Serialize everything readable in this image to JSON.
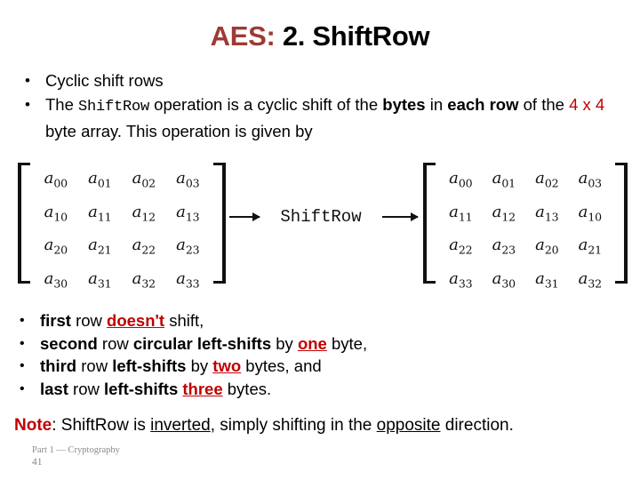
{
  "slide": {
    "title_accent": "AES:",
    "title_main": " 2. ShiftRow",
    "accent_color": "#9e3a35",
    "emphasis_color": "#c00000"
  },
  "intro_bullets": [
    {
      "bullet": "•",
      "parts": [
        {
          "text": "Cyclic shift rows",
          "style": "plain"
        }
      ]
    },
    {
      "bullet": "•",
      "parts": [
        {
          "text": "The ",
          "style": "plain"
        },
        {
          "text": "ShiftRow",
          "style": "mono"
        },
        {
          "text": " operation is a cyclic shift of the ",
          "style": "plain"
        },
        {
          "text": "bytes",
          "style": "bold"
        },
        {
          "text": " in ",
          "style": "plain"
        },
        {
          "text": "each row",
          "style": "bold"
        },
        {
          "text": " of the ",
          "style": "plain"
        },
        {
          "text": "4 x 4",
          "style": "red"
        },
        {
          "text": " byte array. This operation is given by",
          "style": "plain"
        }
      ]
    }
  ],
  "diagram": {
    "input_matrix": {
      "rows": [
        [
          "a00",
          "a01",
          "a02",
          "a03"
        ],
        [
          "a10",
          "a11",
          "a12",
          "a13"
        ],
        [
          "a20",
          "a21",
          "a22",
          "a23"
        ],
        [
          "a30",
          "a31",
          "a32",
          "a33"
        ]
      ]
    },
    "operation_label": "ShiftRow",
    "arrow_left": "⟶",
    "arrow_right": "⟶",
    "output_matrix": {
      "rows": [
        [
          "a00",
          "a01",
          "a02",
          "a03"
        ],
        [
          "a11",
          "a12",
          "a13",
          "a10"
        ],
        [
          "a22",
          "a23",
          "a20",
          "a21"
        ],
        [
          "a33",
          "a30",
          "a31",
          "a32"
        ]
      ]
    }
  },
  "rule_bullets": [
    {
      "bullet": "•",
      "parts": [
        {
          "text": "first",
          "style": "bold"
        },
        {
          "text": " row ",
          "style": "plain"
        },
        {
          "text": "doesn't",
          "style": "red-bold-underline"
        },
        {
          "text": " shift,",
          "style": "plain"
        }
      ]
    },
    {
      "bullet": "•",
      "parts": [
        {
          "text": "second",
          "style": "bold"
        },
        {
          "text": " row ",
          "style": "plain"
        },
        {
          "text": "circular left-shifts",
          "style": "bold"
        },
        {
          "text": " by ",
          "style": "plain"
        },
        {
          "text": "one",
          "style": "red-bold-underline"
        },
        {
          "text": " byte,",
          "style": "plain"
        }
      ]
    },
    {
      "bullet": "•",
      "parts": [
        {
          "text": "third",
          "style": "bold"
        },
        {
          "text": " row ",
          "style": "plain"
        },
        {
          "text": "left-shifts",
          "style": "bold"
        },
        {
          "text": " by ",
          "style": "plain"
        },
        {
          "text": "two",
          "style": "red-bold-underline"
        },
        {
          "text": " bytes, and",
          "style": "plain"
        }
      ]
    },
    {
      "bullet": "•",
      "parts": [
        {
          "text": "last",
          "style": "bold"
        },
        {
          "text": " row ",
          "style": "plain"
        },
        {
          "text": "left-shifts",
          "style": "bold"
        },
        {
          "text": " ",
          "style": "plain"
        },
        {
          "text": "three",
          "style": "red-bold-underline"
        },
        {
          "text": " bytes.",
          "style": "plain"
        }
      ]
    }
  ],
  "note": {
    "parts": [
      {
        "text": "Note",
        "style": "red-bold"
      },
      {
        "text": ": ShiftRow is ",
        "style": "plain"
      },
      {
        "text": "inverted",
        "style": "underline"
      },
      {
        "text": ", simply shifting in the ",
        "style": "plain"
      },
      {
        "text": "opposite",
        "style": "underline"
      },
      {
        "text": " direction.",
        "style": "plain"
      }
    ]
  },
  "footer": {
    "part_label": "Part 1 — Cryptography",
    "page_number": "41"
  }
}
